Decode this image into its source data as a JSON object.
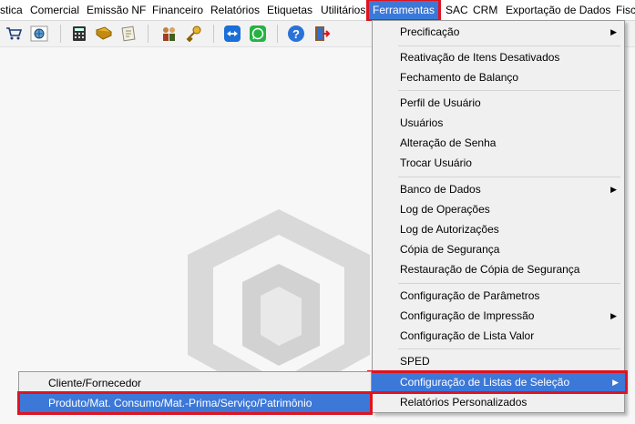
{
  "menubar": {
    "items": [
      "stica",
      "Comercial",
      "Emissão NF",
      "Financeiro",
      "Relatórios",
      "Etiquetas",
      "Utilitários",
      "Ferramentas",
      "SAC",
      "CRM",
      "Exportação de Dados",
      "Fisc"
    ]
  },
  "toolbar": {
    "icons": [
      "cart-icon",
      "globe-icon",
      "calculator-icon",
      "notebook-icon",
      "notepad-icon",
      "users-icon",
      "key-icon",
      "teamviewer-icon",
      "whatsapp-icon",
      "help-icon",
      "exit-icon"
    ]
  },
  "ferramentas_menu": {
    "items": [
      {
        "label": "Precificação",
        "submenu": "▶"
      },
      {
        "label": "Reativação de Itens Desativados"
      },
      {
        "label": "Fechamento de Balanço"
      },
      {
        "label": "Perfil de Usuário"
      },
      {
        "label": "Usuários"
      },
      {
        "label": "Alteração de Senha"
      },
      {
        "label": "Trocar Usuário"
      },
      {
        "label": "Banco de Dados",
        "submenu": "▶"
      },
      {
        "label": "Log de Operações"
      },
      {
        "label": "Log de Autorizações"
      },
      {
        "label": "Cópia de Segurança"
      },
      {
        "label": "Restauração de Cópia de Segurança"
      },
      {
        "label": "Configuração de Parâmetros"
      },
      {
        "label": "Configuração de Impressão",
        "submenu": "▶"
      },
      {
        "label": "Configuração de Lista Valor"
      },
      {
        "label": "SPED"
      },
      {
        "label": "Configuração de Listas de Seleção",
        "submenu": "▶"
      },
      {
        "label": "Relatórios Personalizados"
      }
    ]
  },
  "listas_submenu": {
    "items": [
      {
        "label": "Cliente/Fornecedor"
      },
      {
        "label": "Produto/Mat. Consumo/Mat.-Prima/Serviço/Patrimônio"
      }
    ]
  },
  "colors": {
    "highlight": "#3c78d8",
    "annotation": "#e0131f"
  }
}
